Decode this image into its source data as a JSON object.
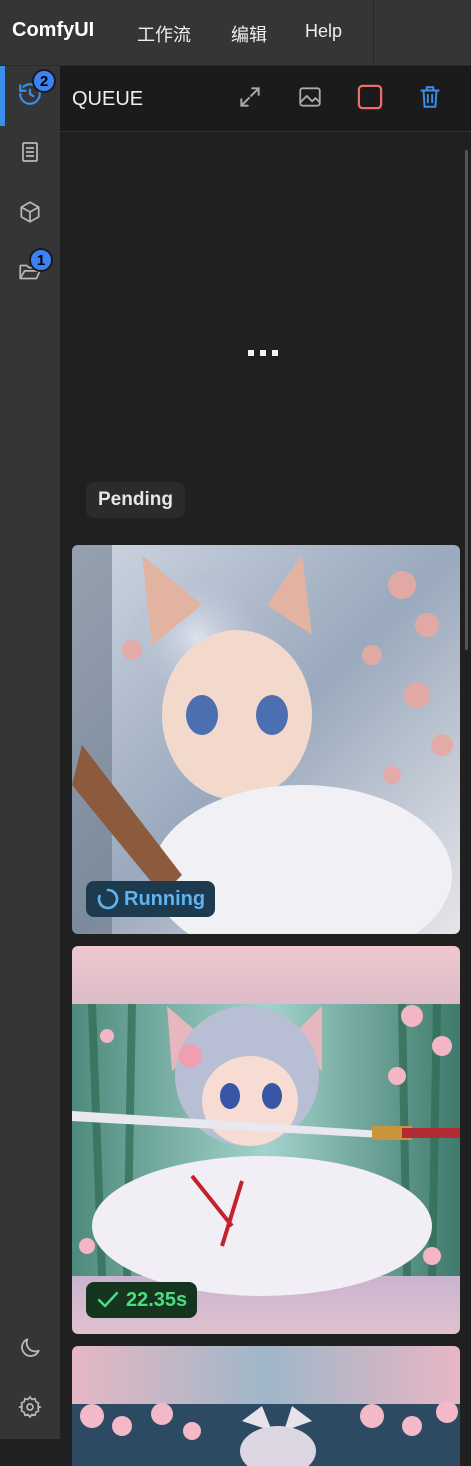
{
  "app": {
    "title": "ComfyUI",
    "menu": [
      "工作流",
      "编辑",
      "Help"
    ]
  },
  "sidebar": {
    "items": [
      {
        "icon": "history-icon",
        "badge": "2",
        "active": true
      },
      {
        "icon": "book-icon"
      },
      {
        "icon": "cube-icon"
      },
      {
        "icon": "folder-open-icon",
        "badge": "1"
      }
    ],
    "bottom": [
      {
        "icon": "moon-icon"
      },
      {
        "icon": "gear-icon"
      }
    ]
  },
  "queue": {
    "title": "QUEUE",
    "actions": [
      "expand-icon",
      "image-icon",
      "stop-icon",
      "trash-icon"
    ],
    "pending_label": "Pending",
    "items": [
      {
        "status": "Running"
      },
      {
        "status": "22.35s"
      }
    ]
  },
  "colors": {
    "accent": "#3b8fea",
    "running_bg": "#1e3a4f",
    "running_text": "#60b4f0",
    "done_bg": "#16351f",
    "done_text": "#4ade80",
    "stop": "#f06b6b"
  }
}
